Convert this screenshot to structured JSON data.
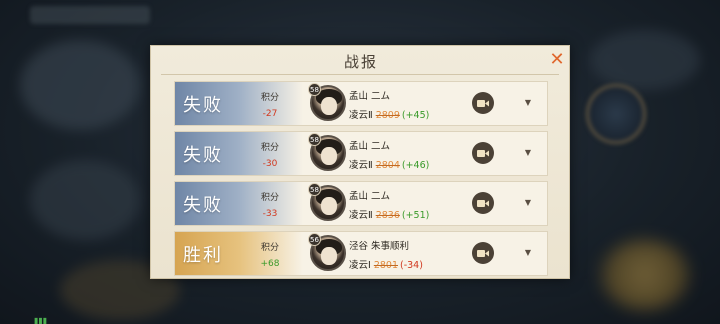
{
  "dialog": {
    "title": "战报",
    "close_icon": "close-icon"
  },
  "score_label": "积分",
  "rows": [
    {
      "result": "失败",
      "outcome": "lose",
      "score": "-27",
      "level": "58",
      "name": "孟山 二ム",
      "rank": "凌云Ⅱ",
      "rating": "2809",
      "delta": "(+45)"
    },
    {
      "result": "失败",
      "outcome": "lose",
      "score": "-30",
      "level": "58",
      "name": "孟山 二ム",
      "rank": "凌云Ⅱ",
      "rating": "2804",
      "delta": "(+46)"
    },
    {
      "result": "失败",
      "outcome": "lose",
      "score": "-33",
      "level": "58",
      "name": "孟山 二ム",
      "rank": "凌云Ⅱ",
      "rating": "2836",
      "delta": "(+51)"
    },
    {
      "result": "胜利",
      "outcome": "win",
      "score": "+68",
      "level": "56",
      "name": "泾谷 朱事顺利",
      "rank": "凌云Ⅰ",
      "rating": "2801",
      "delta": "(-34)"
    }
  ],
  "colors": {
    "lose_panel": "#6f86a6",
    "win_panel": "#d6a451",
    "negative": "#d1381f",
    "positive": "#3a9a2a",
    "rating": "#e08a3c"
  }
}
